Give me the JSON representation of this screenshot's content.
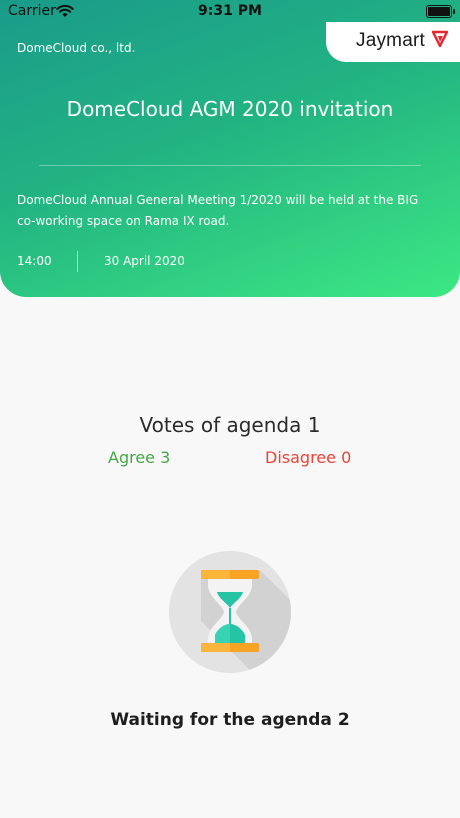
{
  "status_bar": {
    "carrier": "Carrier",
    "time": "9:31 PM"
  },
  "brand": {
    "name": "Jaymart",
    "accent": "#e3262f"
  },
  "header": {
    "company": "DomeCloud co., ltd.",
    "title": "DomeCloud AGM 2020 invitation",
    "description": "DomeCloud Annual General Meeting 1/2020 will be held at the BIG co-working space on Rama IX road.",
    "time": "14:00",
    "date": "30 April 2020"
  },
  "votes": {
    "title": "Votes of agenda 1",
    "agree": "Agree 3",
    "disagree": "Disagree 0",
    "agree_color": "#45a747",
    "disagree_color": "#e8443a"
  },
  "waiting": {
    "icon": "hourglass-icon",
    "text": "Waiting for the agenda 2"
  }
}
